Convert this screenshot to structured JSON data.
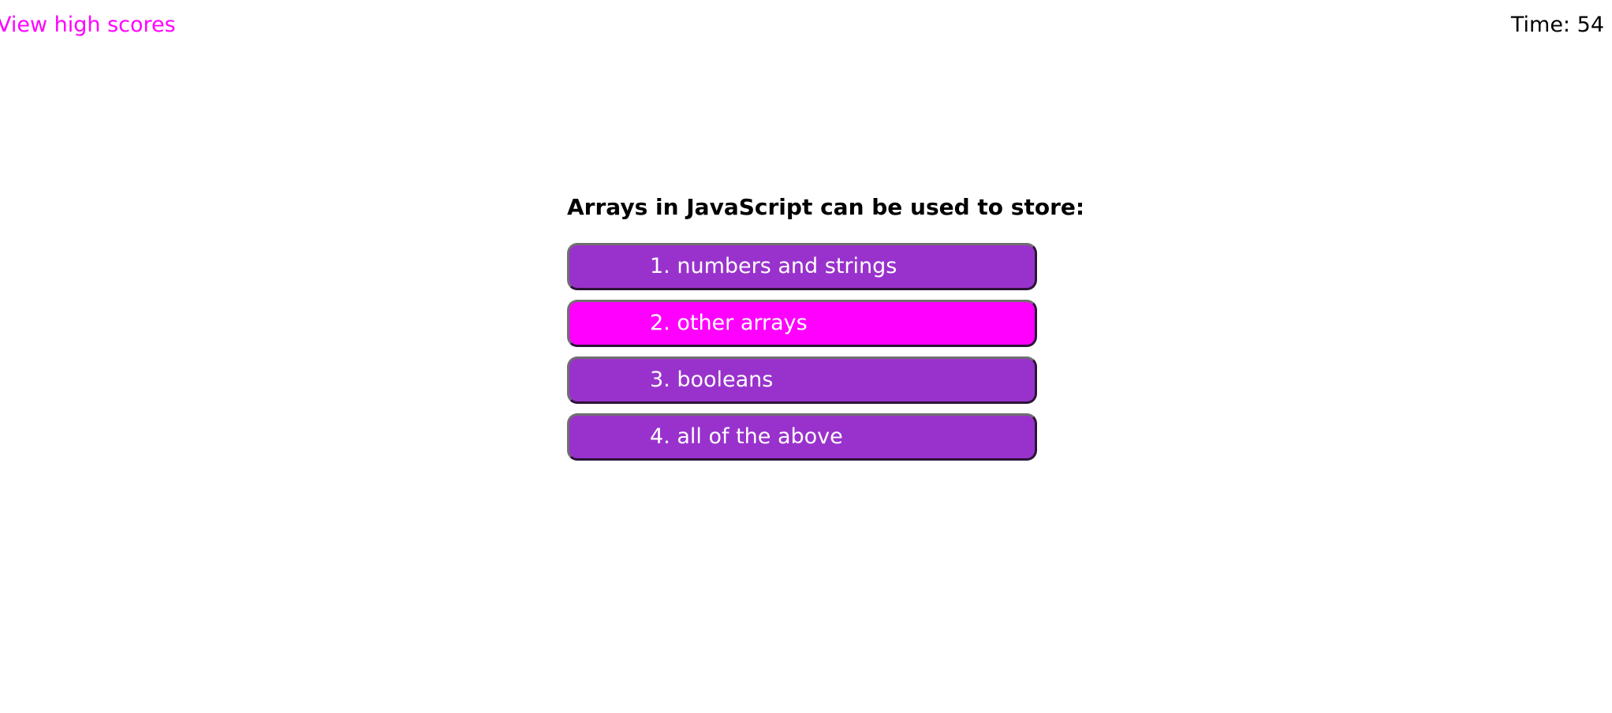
{
  "header": {
    "high_scores_link": "View high scores",
    "timer_label": "Time:",
    "timer_value": "54"
  },
  "quiz": {
    "question": "Arrays in JavaScript can be used to store:",
    "choices": [
      {
        "label": "1. numbers and strings",
        "highlighted": false
      },
      {
        "label": "2. other arrays",
        "highlighted": true
      },
      {
        "label": "3. booleans",
        "highlighted": false
      },
      {
        "label": "4. all of the above",
        "highlighted": false
      }
    ]
  },
  "colors": {
    "link": "#ff00ff",
    "button": "#9932cc",
    "button_highlight": "#ff00ff",
    "button_text": "#ffffff"
  }
}
